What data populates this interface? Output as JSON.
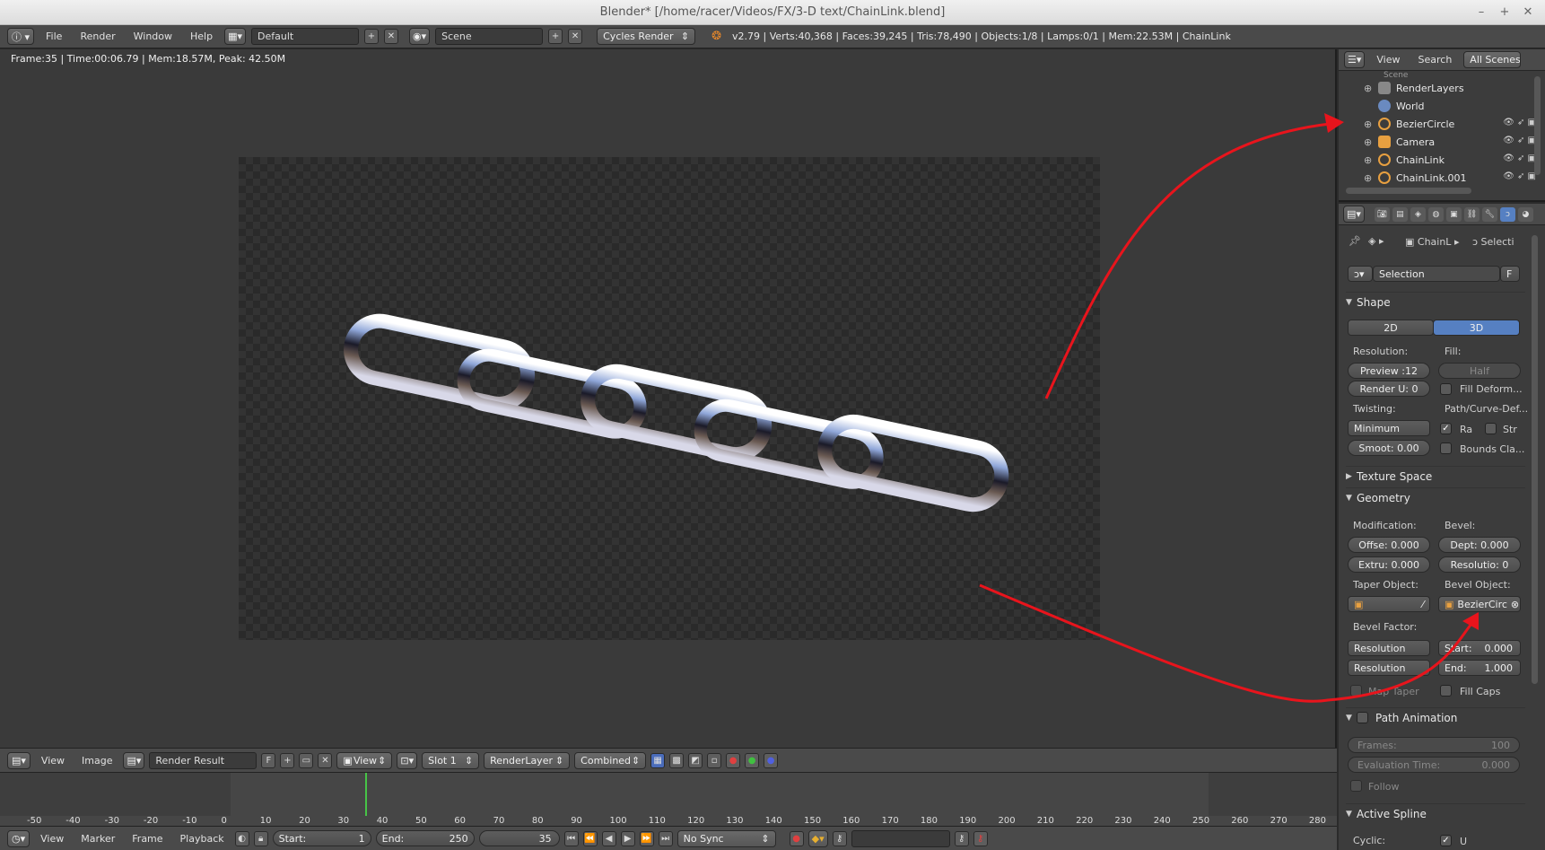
{
  "window": {
    "title": "Blender* [/home/racer/Videos/FX/3-D text/ChainLink.blend]",
    "min": "–",
    "max": "+",
    "close": "✕"
  },
  "infobar": {
    "menus": [
      "File",
      "Render",
      "Window",
      "Help"
    ],
    "layout": "Default",
    "scene": "Scene",
    "engine": "Cycles Render",
    "stats": "v2.79 | Verts:40,368 | Faces:39,245 | Tris:78,490 | Objects:1/8 | Lamps:0/1 | Mem:22.53M | ChainLink"
  },
  "viewport": {
    "info": "Frame:35 | Time:00:06.79 | Mem:18.57M, Peak: 42.50M"
  },
  "image_header": {
    "menus": [
      "View",
      "Image"
    ],
    "image": "Render Result",
    "f_label": "F",
    "view": "View",
    "slot": "Slot 1",
    "layer": "RenderLayer",
    "pass": "Combined"
  },
  "timeline": {
    "ticks": [
      "-50",
      "-40",
      "-30",
      "-20",
      "-10",
      "0",
      "10",
      "20",
      "30",
      "40",
      "50",
      "60",
      "70",
      "80",
      "90",
      "100",
      "110",
      "120",
      "130",
      "140",
      "150",
      "160",
      "170",
      "180",
      "190",
      "200",
      "210",
      "220",
      "230",
      "240",
      "250",
      "260",
      "270",
      "280"
    ],
    "current_frame_marker": 35,
    "menus": [
      "View",
      "Marker",
      "Frame",
      "Playback"
    ],
    "start_label": "Start:",
    "start": "1",
    "end_label": "End:",
    "end": "250",
    "current": "35",
    "sync": "No Sync"
  },
  "outliner": {
    "header": {
      "view": "View",
      "search": "Search",
      "scope": "All Scenes"
    },
    "top_item": "Scene",
    "items": [
      {
        "name": "RenderLayers",
        "icon": "renderlayers-icon"
      },
      {
        "name": "World",
        "icon": "world-icon"
      },
      {
        "name": "BezierCircle",
        "icon": "curve-icon"
      },
      {
        "name": "Camera",
        "icon": "camera-icon"
      },
      {
        "name": "ChainLink",
        "icon": "curve-icon"
      },
      {
        "name": "ChainLink.001",
        "icon": "curve-icon"
      }
    ]
  },
  "properties": {
    "breadcrumb": {
      "object": "ChainL",
      "data": "Selecti"
    },
    "datablock": "Selection",
    "datablock_f": "F",
    "shape": {
      "title": "Shape",
      "mode_2d": "2D",
      "mode_3d": "3D",
      "resolution_label": "Resolution:",
      "preview": "Preview :12",
      "render_u": "Render U: 0",
      "fill_label": "Fill:",
      "fill_value": "Half",
      "fill_deform": "Fill Deform...",
      "twisting_label": "Twisting:",
      "twisting": "Minimum",
      "smooth": "Smoot: 0.00",
      "path_label": "Path/Curve-Def...",
      "radius": "Ra",
      "stretch": "Str",
      "bounds": "Bounds Cla..."
    },
    "texture_space": {
      "title": "Texture Space"
    },
    "geometry": {
      "title": "Geometry",
      "modification_label": "Modification:",
      "bevel_label": "Bevel:",
      "offset": "Offse: 0.000",
      "extrude": "Extru: 0.000",
      "depth": "Dept: 0.000",
      "resolution": "Resolutio:  0",
      "taper_label": "Taper Object:",
      "bevel_obj_label": "Bevel Object:",
      "bevel_object": "BezierCirc",
      "bevel_factor_label": "Bevel Factor:",
      "factor_mode_1": "Resolution",
      "factor_mode_2": "Resolution",
      "start_label": "Start:",
      "start": "0.000",
      "end_label": "End:",
      "end": "1.000",
      "map_taper": "Map Taper",
      "fill_caps": "Fill Caps"
    },
    "path_animation": {
      "title": "Path Animation",
      "frames_label": "Frames:",
      "frames": "100",
      "eval_label": "Evaluation Time:",
      "eval": "0.000",
      "follow": "Follow"
    },
    "active_spline": {
      "title": "Active Spline",
      "cyclic_label": "Cyclic:",
      "cyclic_u": "U"
    }
  },
  "colors": {
    "annotation_arrow": "#e8141c",
    "selected_tab": "#5680c2",
    "timeline_marker": "#47c447"
  }
}
